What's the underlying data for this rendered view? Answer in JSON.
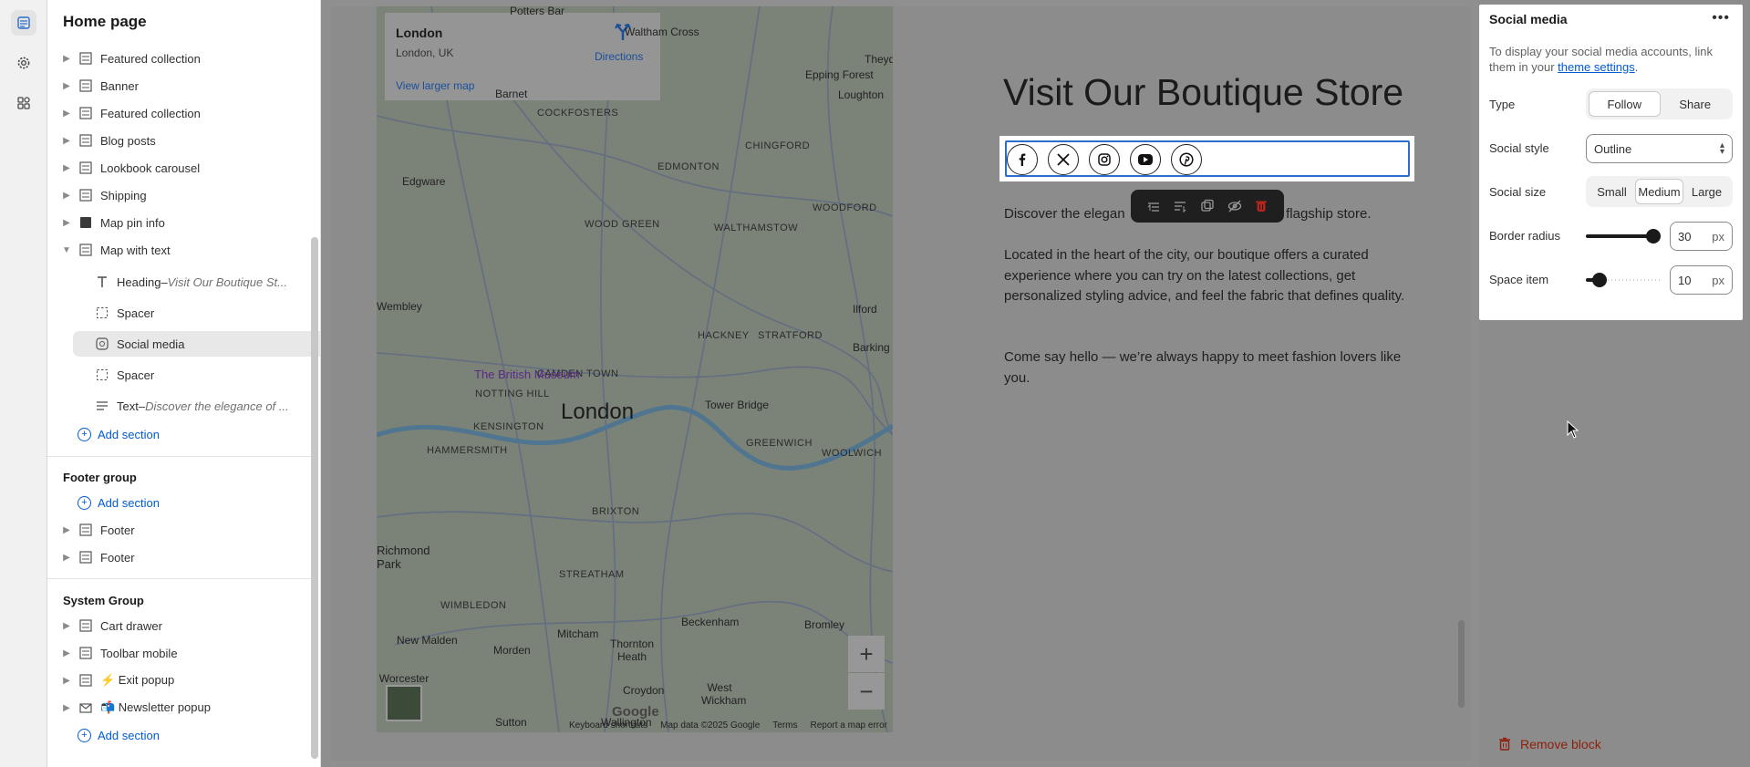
{
  "sidebar": {
    "title": "Home page",
    "items": [
      {
        "label": "Featured collection"
      },
      {
        "label": "Banner"
      },
      {
        "label": "Featured collection"
      },
      {
        "label": "Blog posts"
      },
      {
        "label": "Lookbook carousel"
      },
      {
        "label": "Shipping"
      },
      {
        "label": "Map pin info"
      },
      {
        "label": "Map with text"
      }
    ],
    "children": [
      {
        "label": "Heading",
        "suffix": " – ",
        "detail": "Visit Our Boutique St..."
      },
      {
        "label": "Spacer"
      },
      {
        "label": "Social media"
      },
      {
        "label": "Spacer"
      },
      {
        "label": "Text",
        "suffix": " – ",
        "detail": "Discover the elegance of ..."
      }
    ],
    "add_section": "Add section",
    "footer_group": {
      "title": "Footer group",
      "add_section": "Add section",
      "items": [
        {
          "label": "Footer"
        },
        {
          "label": "Footer"
        }
      ]
    },
    "system_group": {
      "title": "System Group",
      "items": [
        {
          "label": "Cart drawer"
        },
        {
          "label": "Toolbar mobile"
        },
        {
          "label": "⚡ Exit popup"
        },
        {
          "label": "📬 Newsletter popup"
        }
      ],
      "add_section": "Add section"
    }
  },
  "map": {
    "place": "London",
    "address": "London, UK",
    "directions": "Directions",
    "view_larger": "View larger map",
    "city_label": "London",
    "labels": [
      "Potters Bar",
      "Waltham Cross",
      "Theydo",
      "Epping Forest",
      "Loughton",
      "Barnet",
      "COCKFOSTERS",
      "CHINGFORD",
      "Edgware",
      "EDMONTON",
      "WOOD GREEN",
      "WALTHAMSTOW",
      "WOODFORD",
      "Wembley",
      "HACKNEY",
      "STRATFORD",
      "Ilford",
      "CAMDEN TOWN",
      "Barking",
      "The British Museum",
      "NOTTING HILL",
      "Tower Bridge",
      "KENSINGTON",
      "GREENWICH",
      "WOOLWICH",
      "HAMMERSMITH",
      "BRIXTON",
      "Richmond Park",
      "STREATHAM",
      "WIMBLEDON",
      "Beckenham",
      "Bromley",
      "New Malden",
      "Morden",
      "Mitcham",
      "Thornton Heath",
      "Worcester Park",
      "Croydon",
      "West Wickham",
      "Sutton",
      "Wallington"
    ],
    "footer": [
      "Keyboard shortcuts",
      "Map data ©2025 Google",
      "Terms",
      "Report a map error"
    ],
    "google": "Google",
    "zoom_in": "+",
    "zoom_out": "−"
  },
  "content": {
    "heading": "Visit Our Boutique Store",
    "p1_start": "Discover the elegan",
    "p1_end": "at our flagship store.",
    "p2": "Located in the heart of the city, our boutique offers a curated experience where you can try on the latest collections, get personalized styling advice, and feel the fabric that defines quality.",
    "p3": "Come say hello — we’re always happy to meet fashion lovers like you.",
    "social_icons": [
      "facebook-icon",
      "x-icon",
      "instagram-icon",
      "youtube-icon",
      "pinterest-icon"
    ]
  },
  "panel": {
    "title": "Social media",
    "desc_before": "To display your social media accounts, link them in your ",
    "desc_link": "theme settings",
    "desc_after": ".",
    "type_label": "Type",
    "type_options": [
      "Follow",
      "Share"
    ],
    "type_selected": "Follow",
    "style_label": "Social style",
    "style_value": "Outline",
    "size_label": "Social size",
    "size_options": [
      "Small",
      "Medium",
      "Large"
    ],
    "size_selected": "Medium",
    "radius_label": "Border radius",
    "radius_value": "30",
    "radius_level": 1.0,
    "space_label": "Space item",
    "space_value": "10",
    "space_level": 0.1,
    "unit": "px",
    "remove": "Remove block"
  }
}
